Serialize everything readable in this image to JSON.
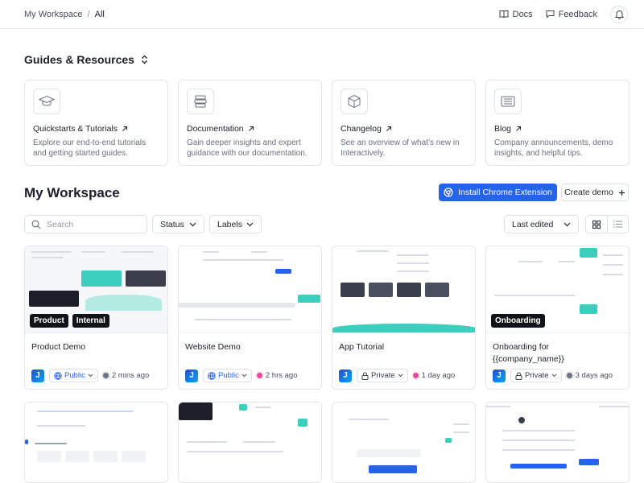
{
  "breadcrumb": {
    "workspace": "My Workspace",
    "separator": "/",
    "current": "All"
  },
  "header": {
    "docs_label": "Docs",
    "feedback_label": "Feedback"
  },
  "guides": {
    "title": "Guides & Resources",
    "items": [
      {
        "icon": "graduation-cap-icon",
        "title": "Quickstarts & Tutorials",
        "desc": "Explore our end-to-end tutorials and getting started guides."
      },
      {
        "icon": "books-icon",
        "title": "Documentation",
        "desc": "Gain deeper insights and expert guidance with our documentation."
      },
      {
        "icon": "cube-icon",
        "title": "Changelog",
        "desc": "See an overview of what’s new in Interactively."
      },
      {
        "icon": "newspaper-icon",
        "title": "Blog",
        "desc": "Company announcements, demo insights, and helpful tips."
      }
    ]
  },
  "workspace": {
    "title": "My Workspace",
    "install_label": "Install Chrome Extension",
    "create_label": "Create demo",
    "search_placeholder": "Search",
    "status_label": "Status",
    "labels_label": "Labels",
    "sort_label": "Last edited"
  },
  "colors": {
    "accent": "#2563eb",
    "teal": "#3ccfbd",
    "pink": "#ec4899",
    "gray": "#6b7280"
  },
  "demos": [
    {
      "title": "Product Demo",
      "tags": [
        "Product",
        "Internal"
      ],
      "avatar": "J",
      "visibility": "Public",
      "time": "2 mins ago",
      "dot": "#6b7280"
    },
    {
      "title": "Website Demo",
      "tags": [],
      "avatar": "J",
      "visibility": "Public",
      "time": "2 hrs ago",
      "dot": "#ec4899"
    },
    {
      "title": "App Tutorial",
      "tags": [],
      "avatar": "J",
      "visibility": "Private",
      "time": "1 day ago",
      "dot": "#ec4899"
    },
    {
      "title": "Onboarding for {{company_name}}",
      "tags": [
        "Onboarding"
      ],
      "avatar": "J",
      "visibility": "Private",
      "time": "3 days ago",
      "dot": "#6b7280"
    }
  ]
}
